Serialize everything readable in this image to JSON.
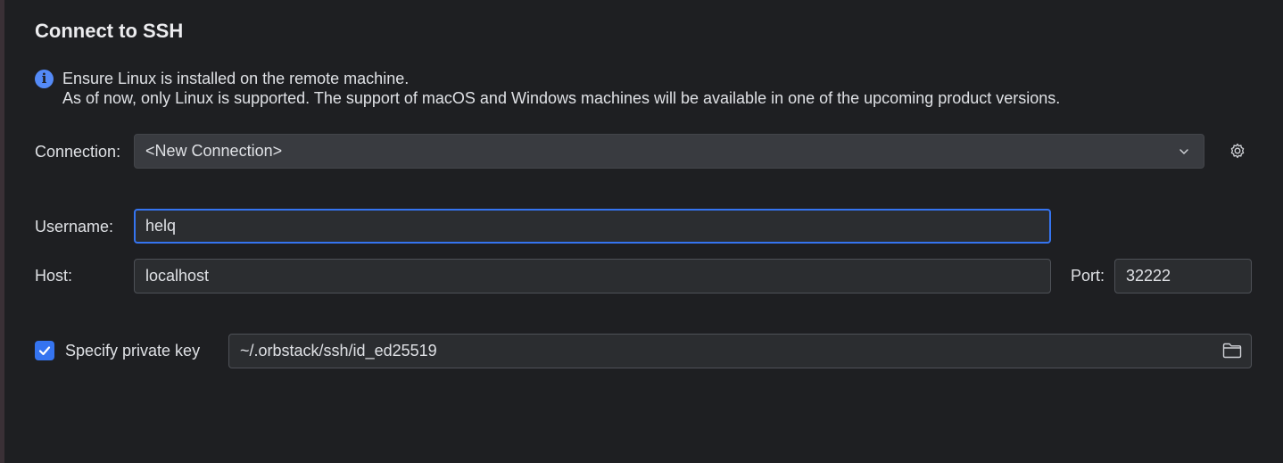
{
  "dialog": {
    "title": "Connect to SSH"
  },
  "info": {
    "icon": "info-icon",
    "line1": "Ensure Linux is installed on the remote machine.",
    "line2": "As of now, only Linux is supported. The support of macOS and Windows machines will be available in one of the upcoming product versions."
  },
  "connection": {
    "label": "Connection:",
    "selected": "<New Connection>",
    "settings_icon": "gear-icon"
  },
  "username": {
    "label": "Username:",
    "value": "helq"
  },
  "host": {
    "label": "Host:",
    "value": "localhost"
  },
  "port": {
    "label": "Port:",
    "value": "32222"
  },
  "private_key": {
    "checkbox_label": "Specify private key",
    "checked": true,
    "path": "~/.orbstack/ssh/id_ed25519",
    "browse_icon": "folder-icon"
  },
  "colors": {
    "accent": "#3574f0",
    "background": "#1e1f22",
    "field_bg": "#2b2d30",
    "info_icon": "#548af7"
  }
}
